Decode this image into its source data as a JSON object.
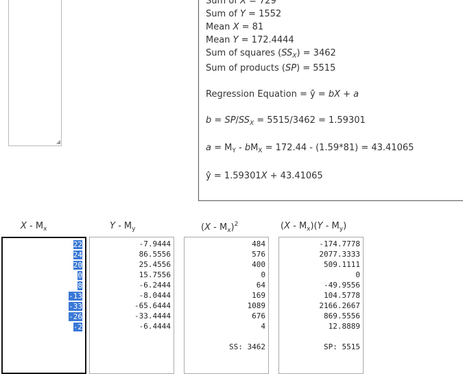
{
  "summary": {
    "sum_x": "Sum of X = 729",
    "sum_y": "Sum of Y = 1552",
    "mean_x": "Mean X = 81",
    "mean_y": "Mean Y = 172.4444",
    "ss_x": "Sum of squares (SSX) = 3462",
    "sp": "Sum of products (SP) = 5515",
    "regression_equation": "Regression Equation = ŷ = bX + a",
    "b_calc": "b = SP/SSX = 5515/3462 = 1.59301",
    "a_calc": "a = MY - bMX = 172.44 - (1.59*81) = 43.41065",
    "y_hat": "ŷ = 1.59301X + 43.41065"
  },
  "columns": {
    "x_minus_mx": {
      "header": "X - Mx",
      "values": [
        "22",
        "24",
        "20",
        "0",
        "8",
        "-13",
        "-33",
        "-26",
        "-2"
      ]
    },
    "y_minus_my": {
      "header": "Y - My",
      "values": [
        "-7.9444",
        "86.5556",
        "25.4556",
        "15.7556",
        "-6.2444",
        "-8.0444",
        "-65.6444",
        "-33.4444",
        "-6.4444"
      ]
    },
    "x_minus_mx_sq": {
      "header": "(X - Mx)2",
      "values": [
        "484",
        "576",
        "400",
        "0",
        "64",
        "169",
        "1089",
        "676",
        "4"
      ],
      "total": "SS: 3462"
    },
    "products": {
      "header": "(X - Mx)(Y - My)",
      "values": [
        "-174.7778",
        "2077.3333",
        "509.1111",
        "0",
        "-49.9556",
        "104.5778",
        "2166.2667",
        "869.5556",
        "12.8889"
      ],
      "total": "SP: 5515"
    }
  }
}
